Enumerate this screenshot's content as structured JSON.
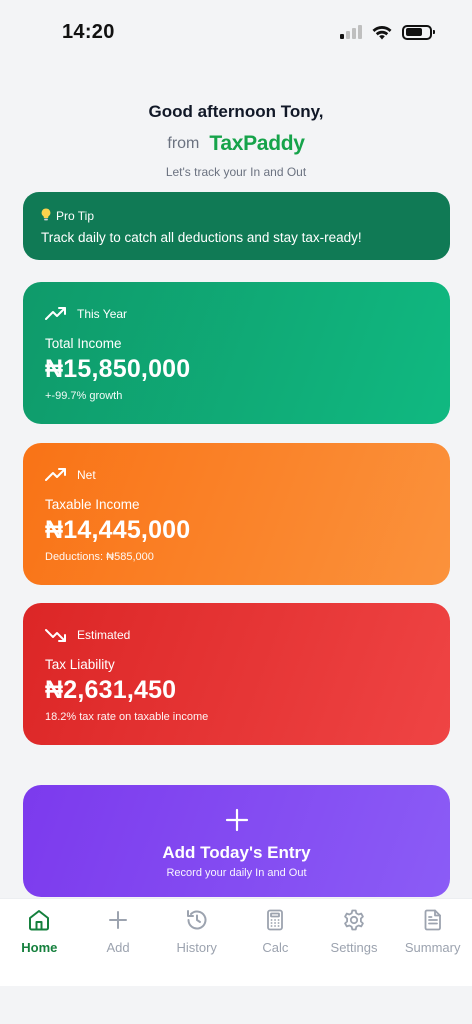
{
  "status_bar": {
    "time": "14:20"
  },
  "greeting": {
    "title": "Good afternoon Tony,",
    "from_label": "from",
    "brand": "TaxPaddy",
    "tagline": "Let's track your In and Out"
  },
  "pro_tip": {
    "label": "Pro Tip",
    "text": "Track daily to catch all deductions and stay tax-ready!"
  },
  "cards": [
    {
      "period": "This Year",
      "label": "Total Income",
      "value": "₦15,850,000",
      "sub": "+-99.7% growth",
      "trend": "up"
    },
    {
      "period": "Net",
      "label": "Taxable Income",
      "value": "₦14,445,000",
      "sub": "Deductions: ₦585,000",
      "trend": "up"
    },
    {
      "period": "Estimated",
      "label": "Tax Liability",
      "value": "₦2,631,450",
      "sub": "18.2% tax rate on taxable income",
      "trend": "down"
    }
  ],
  "add_entry": {
    "title": "Add Today's Entry",
    "subtitle": "Record your daily In and Out"
  },
  "tabs": [
    {
      "label": "Home",
      "icon": "home-icon",
      "active": true
    },
    {
      "label": "Add",
      "icon": "plus-icon",
      "active": false
    },
    {
      "label": "History",
      "icon": "history-icon",
      "active": false
    },
    {
      "label": "Calc",
      "icon": "calculator-icon",
      "active": false
    },
    {
      "label": "Settings",
      "icon": "gear-icon",
      "active": false
    },
    {
      "label": "Summary",
      "icon": "document-icon",
      "active": false
    }
  ],
  "colors": {
    "brand": "#16a34a",
    "income": "#10b981",
    "taxable": "#f97316",
    "liability": "#ef4444",
    "add": "#7c3aed",
    "tip": "#107a55"
  }
}
